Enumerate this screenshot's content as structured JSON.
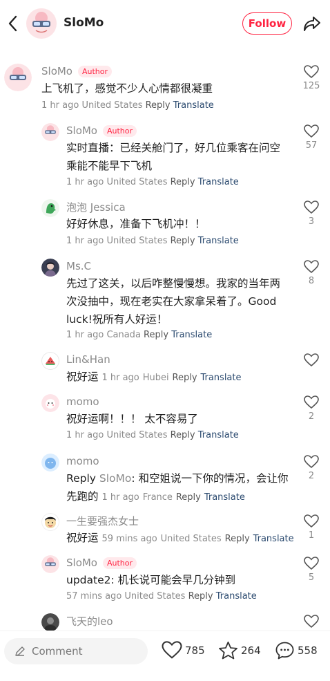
{
  "header": {
    "title": "SloMo",
    "follow_label": "Follow"
  },
  "comments": [
    {
      "name": "SloMo",
      "badge": "Author",
      "text": "上飞机了，感觉不少人心情都很凝重",
      "time": "1 hr ago",
      "location": "United States",
      "reply": "Reply",
      "translate": "Translate",
      "likes": "125"
    },
    {
      "name": "SloMo",
      "badge": "Author",
      "text": "实时直播：已经关舱门了，好几位乘客在问空乘能不能早下飞机",
      "time": "1 hr ago",
      "location": "United States",
      "reply": "Reply",
      "translate": "Translate",
      "likes": "57"
    },
    {
      "name": "泡泡 Jessica",
      "text": "好好休息，准备下飞机冲！！",
      "time": "1 hr ago",
      "location": "United States",
      "reply": "Reply",
      "translate": "Translate",
      "likes": "3"
    },
    {
      "name": "Ms.C",
      "text": "先过了这关，以后咋整慢慢想。我家的当年两次没抽中，现在老实在大家拿呆着了。Good luck!祝所有人好运！",
      "time": "1 hr ago",
      "location": "Canada",
      "reply": "Reply",
      "translate": "Translate",
      "likes": "8"
    },
    {
      "name": "Lin&Han",
      "text": "祝好运",
      "time": "1 hr ago",
      "location": "Hubei",
      "reply": "Reply",
      "translate": "Translate",
      "likes": ""
    },
    {
      "name": "momo",
      "text": "祝好运啊！！！ 太不容易了",
      "time": "1 hr ago",
      "location": "United States",
      "reply": "Reply",
      "translate": "Translate",
      "likes": "2"
    },
    {
      "name": "momo",
      "reply_prefix": "Reply",
      "mention": "SloMo",
      "text": ": 和空姐说一下你的情况，会让你先跑的",
      "time": "1 hr ago",
      "location": "France",
      "reply": "Reply",
      "translate": "Translate",
      "likes": "2"
    },
    {
      "name": "一生要强杰女士",
      "text": "祝好运",
      "time": "59 mins ago",
      "location": "United States",
      "reply": "Reply",
      "translate": "Translate",
      "likes": "1"
    },
    {
      "name": "SloMo",
      "badge": "Author",
      "text": "update2: 机长说可能会早几分钟到",
      "time": "57 mins ago",
      "location": "United States",
      "reply": "Reply",
      "translate": "Translate",
      "likes": "5"
    },
    {
      "name": "飞天的leo"
    }
  ],
  "bottom_bar": {
    "comment_placeholder": "Comment",
    "likes": "785",
    "stars": "264",
    "comments": "558"
  },
  "colors": {
    "accent": "#ff2442",
    "translate": "#2b4a6f",
    "muted": "#8a8a8a"
  }
}
